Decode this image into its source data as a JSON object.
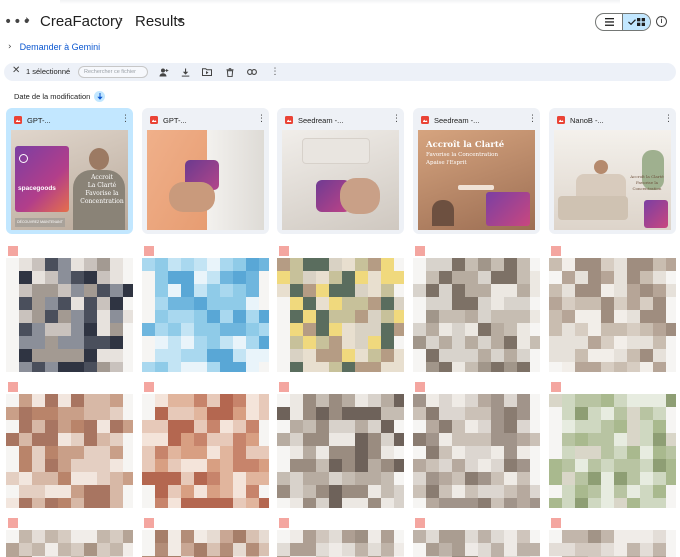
{
  "header": {
    "more_label": "•••",
    "breadcrumb": [
      "CreaFactory",
      "Results"
    ],
    "view": {
      "list_icon": "list-icon",
      "grid_icon": "grid-icon",
      "active": "grid"
    },
    "info_icon": "info-icon"
  },
  "gemini": {
    "label": "Demander à Gemini"
  },
  "actionbar": {
    "selected_count": "1 sélectionné",
    "search_placeholder": "Rechercher ce fichier",
    "icons": [
      "close-icon",
      "add-person-icon",
      "download-icon",
      "move-to-folder-icon",
      "trash-icon",
      "link-icon",
      "more-vert-icon"
    ]
  },
  "sort": {
    "label": "Date de la modification",
    "direction": "descending"
  },
  "files": [
    {
      "name": "GPT-...",
      "selected": true
    },
    {
      "name": "GPT-...",
      "selected": false
    },
    {
      "name": "Seedream -...",
      "selected": false
    },
    {
      "name": "Seedream -...",
      "selected": false
    },
    {
      "name": "NanoB -...",
      "selected": false
    }
  ],
  "thumb_text": {
    "card1_brand": "spacegoods",
    "card1_overlay": [
      "Accroit",
      "La Clarté",
      "Favorise la",
      "Concentration"
    ],
    "card1_footer": "DÉCOUVREZ MAINTENANT",
    "card4_overlay": [
      "Accroît la Clarté",
      "Favorise la Concentration",
      "Apaise l'Esprit"
    ],
    "card5_overlay": [
      "Accroît la Clarté",
      "Favorise la Concentration"
    ]
  },
  "colors": {
    "accent": "#0b57d0",
    "selected": "#c2e7ff",
    "card_bg": "#eef1f6",
    "file_red": "#ea4335"
  }
}
